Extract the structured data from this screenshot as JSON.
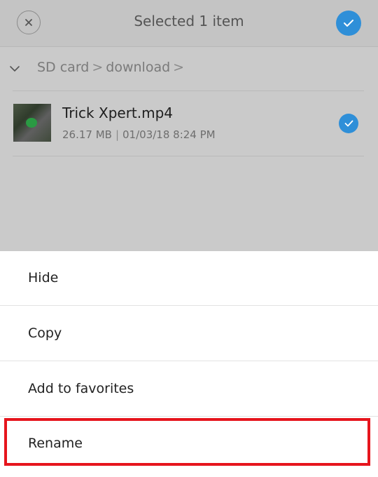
{
  "header": {
    "title": "Selected 1 item",
    "close_icon": "close-icon",
    "confirm_icon": "check-icon",
    "accent_color": "#2f8fd8"
  },
  "breadcrumb": {
    "toggle_icon": "chevron-down-icon",
    "items": [
      "SD card",
      "download"
    ],
    "separator": ">"
  },
  "file": {
    "name": "Trick Xpert.mp4",
    "size": "26.17 MB",
    "date": "01/03/18 8:24 PM",
    "meta_separator": "|",
    "selected": true
  },
  "menu": {
    "items": [
      {
        "label": "Hide"
      },
      {
        "label": "Copy"
      },
      {
        "label": "Add to favorites"
      },
      {
        "label": "Rename",
        "highlighted": true
      }
    ],
    "highlight_color": "#e6151d"
  }
}
